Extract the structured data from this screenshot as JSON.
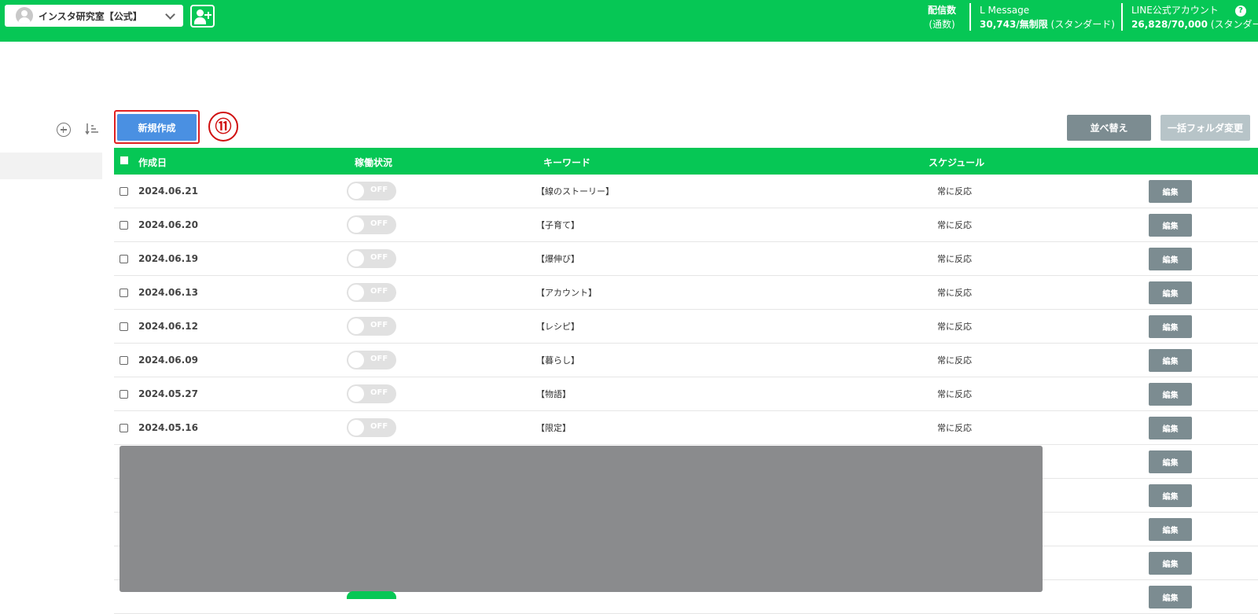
{
  "header": {
    "account_name": "インスタ研究室【公式】",
    "delivery_label": "配信数",
    "delivery_sub": "(通数)",
    "lmessage_label": "L Message",
    "lmessage_value": "30,743/無制限",
    "lmessage_plan": "(スタンダード)",
    "line_label": "LINE公式アカウント",
    "line_value": "26,828/70,000",
    "line_plan": "(スタンダー",
    "help": "?"
  },
  "toolbar": {
    "new_label": "新規作成",
    "step_marker": "⑪",
    "sort_label": "並べ替え",
    "folder_label": "一括フォルダ変更"
  },
  "table": {
    "columns": {
      "date": "作成日",
      "status": "稼働状況",
      "keyword": "キーワード",
      "schedule": "スケジュール"
    },
    "edit_label": "編集",
    "off_label": "OFF",
    "rows": [
      {
        "date": "2024.06.21",
        "keyword": "【線のストーリー】",
        "schedule": "常に反応"
      },
      {
        "date": "2024.06.20",
        "keyword": "【子育て】",
        "schedule": "常に反応"
      },
      {
        "date": "2024.06.19",
        "keyword": "【爆伸び】",
        "schedule": "常に反応"
      },
      {
        "date": "2024.06.13",
        "keyword": "【アカウント】",
        "schedule": "常に反応"
      },
      {
        "date": "2024.06.12",
        "keyword": "【レシピ】",
        "schedule": "常に反応"
      },
      {
        "date": "2024.06.09",
        "keyword": "【暮らし】",
        "schedule": "常に反応"
      },
      {
        "date": "2024.05.27",
        "keyword": "【物語】",
        "schedule": "常に反応"
      },
      {
        "date": "2024.05.16",
        "keyword": "【限定】",
        "schedule": "常に反応"
      }
    ]
  }
}
